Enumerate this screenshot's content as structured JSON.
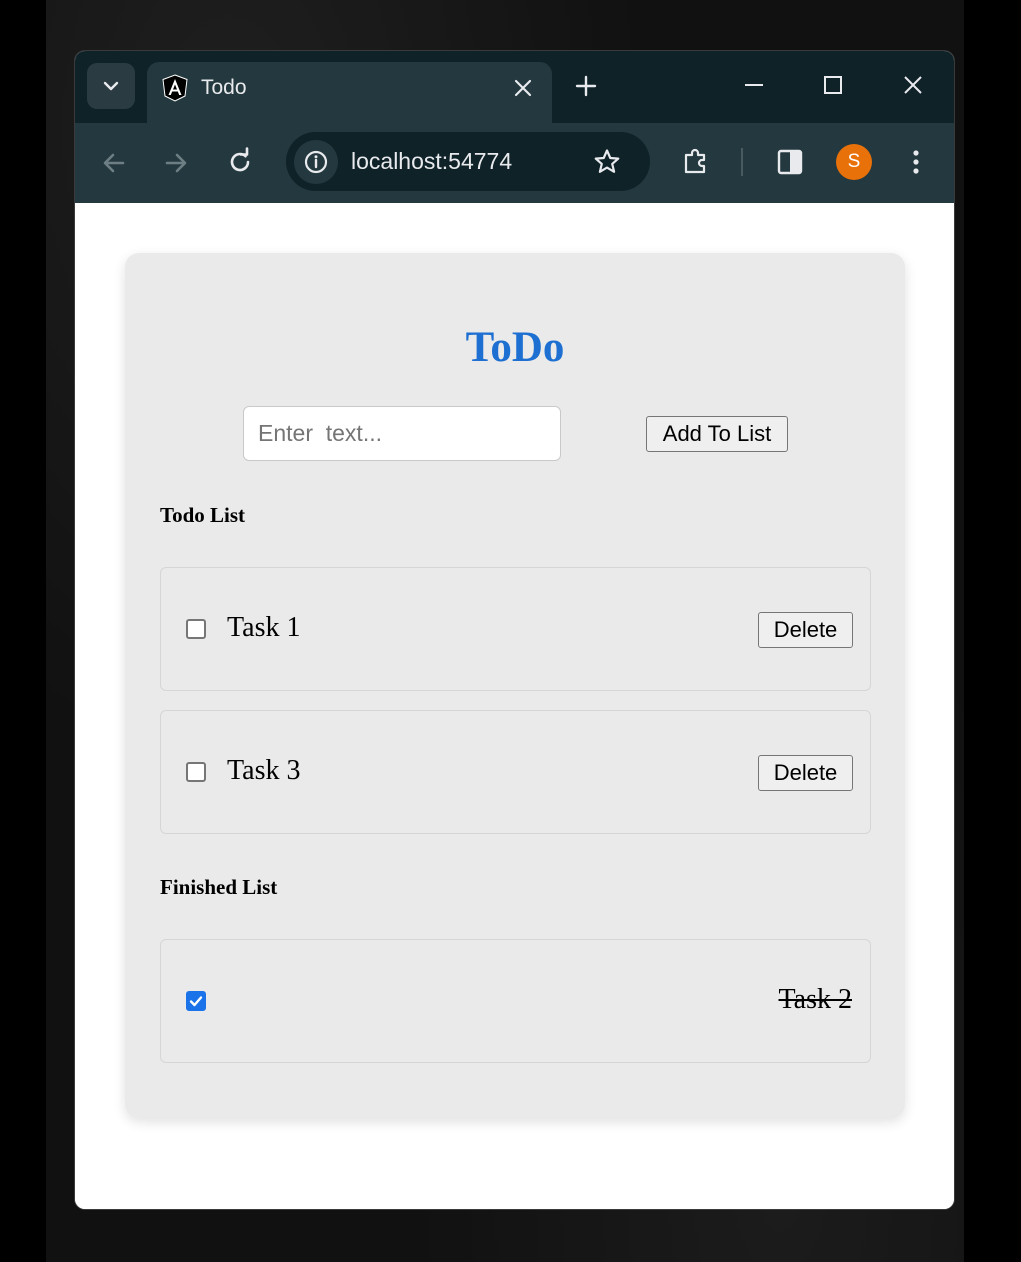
{
  "browser": {
    "tab": {
      "title": "Todo"
    },
    "address_bar": {
      "url": "localhost:54774"
    },
    "profile": {
      "initial": "S",
      "color": "#e8710a"
    }
  },
  "app": {
    "title": "ToDo",
    "input": {
      "placeholder": "Enter  text...",
      "value": ""
    },
    "add_button_label": "Add To List",
    "todo_heading": "Todo List",
    "todo_items": [
      {
        "label": "Task 1",
        "checked": false,
        "delete_label": "Delete"
      },
      {
        "label": "Task 3",
        "checked": false,
        "delete_label": "Delete"
      }
    ],
    "finished_heading": "Finished List",
    "finished_items": [
      {
        "label": "Task 2",
        "checked": true
      }
    ],
    "colors": {
      "title": "#1d6fd1",
      "checkbox_checked": "#1a73e8",
      "card_bg": "#e9eae9"
    }
  }
}
